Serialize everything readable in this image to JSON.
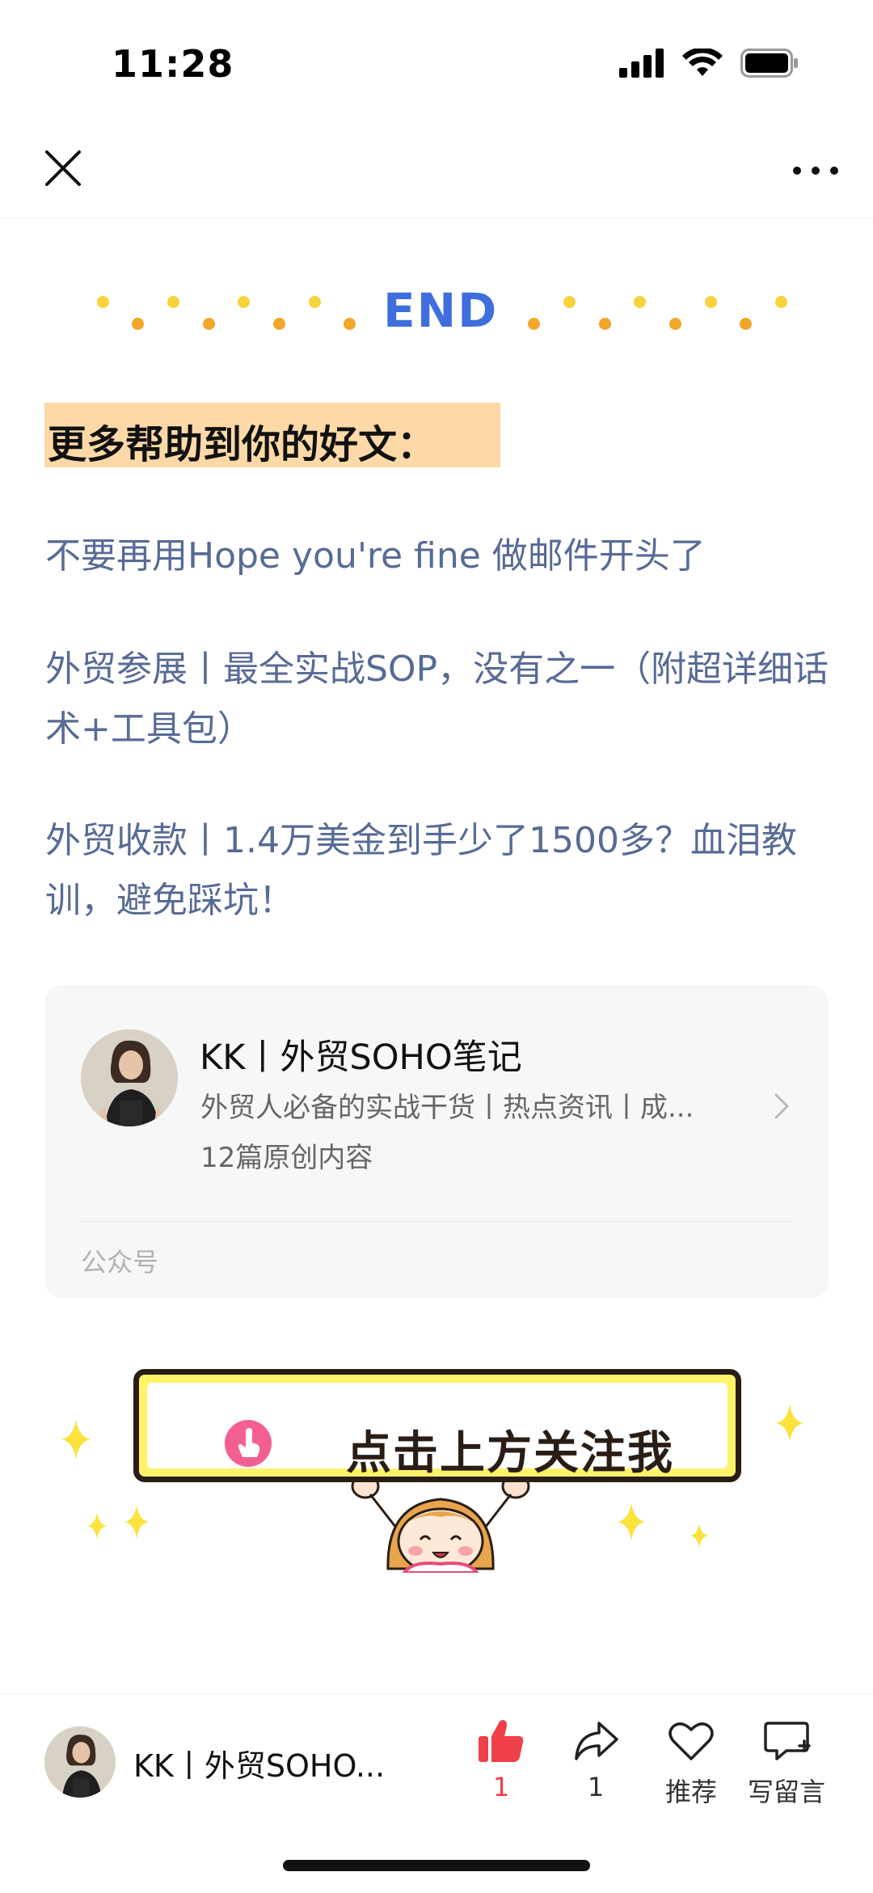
{
  "status_bar": {
    "time": "11:28"
  },
  "end_banner": {
    "text": "END"
  },
  "heading": "更多帮助到你的好文：",
  "articles": [
    "不要再用Hope you're fine 做邮件开头了",
    "外贸参展丨最全实战SOP，没有之一（附超详细话术+工具包）",
    "外贸收款丨1.4万美金到手少了1500多？血泪教训，避免踩坑！"
  ],
  "account_card": {
    "name": "KK丨外贸SOHO笔记",
    "description": "外贸人必备的实战干货丨热点资讯丨成...",
    "count": "12篇原创内容",
    "type": "公众号"
  },
  "follow_banner": {
    "text": "点击上方关注我"
  },
  "bottom_bar": {
    "name": "KK丨外贸SOHO...",
    "like_count": "1",
    "share_count": "1",
    "recommend_label": "推荐",
    "comment_label": "写留言"
  },
  "colors": {
    "link": "#576b95",
    "accent_blue": "#3e6fdc",
    "like_red": "#f0404a",
    "heading_bg": "#fcd9a7"
  },
  "icons": [
    "close-icon",
    "more-icon",
    "chevron-right-icon",
    "thumbs-up-icon",
    "share-icon",
    "heart-icon",
    "comment-icon",
    "signal-icon",
    "wifi-icon",
    "battery-icon"
  ]
}
